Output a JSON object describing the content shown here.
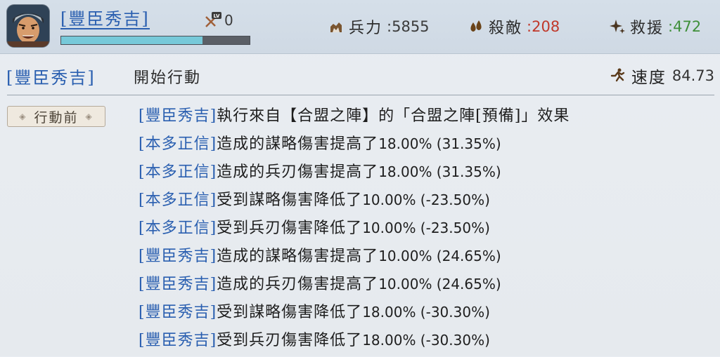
{
  "header": {
    "hero_name": "[豐臣秀吉]",
    "level_value": "0",
    "level_badge": "LV",
    "hp_fraction": 0.75,
    "stats": {
      "troops": {
        "label": "兵力",
        "value": ":5855",
        "icon": "troops-icon"
      },
      "kills": {
        "label": "殺敵",
        "value": ":208",
        "icon": "blood-drops-icon",
        "color": "#c0392b"
      },
      "rescue": {
        "label": "救援",
        "value": ":472",
        "icon": "sparkle-icon",
        "color": "#3f8f3a"
      }
    }
  },
  "turn": {
    "actor": "[豐臣秀吉]",
    "action": "開始行動",
    "speed_label": "速度",
    "speed_value": "84.73"
  },
  "phase_label": "行動前",
  "log": [
    {
      "who": "[豐臣秀吉]",
      "text": "執行來自【合盟之陣】的「合盟之陣[預備]」效果",
      "num": ""
    },
    {
      "who": "[本多正信]",
      "text": "造成的謀略傷害提高了",
      "num": "18.00% (31.35%)"
    },
    {
      "who": "[本多正信]",
      "text": "造成的兵刃傷害提高了",
      "num": "18.00% (31.35%)"
    },
    {
      "who": "[本多正信]",
      "text": "受到謀略傷害降低了",
      "num": "10.00% (-23.50%)"
    },
    {
      "who": "[本多正信]",
      "text": "受到兵刃傷害降低了",
      "num": "10.00% (-23.50%)"
    },
    {
      "who": "[豐臣秀吉]",
      "text": "造成的謀略傷害提高了",
      "num": "10.00% (24.65%)"
    },
    {
      "who": "[豐臣秀吉]",
      "text": "造成的兵刃傷害提高了",
      "num": "10.00% (24.65%)"
    },
    {
      "who": "[豐臣秀吉]",
      "text": "受到謀略傷害降低了",
      "num": "18.00% (-30.30%)"
    },
    {
      "who": "[豐臣秀吉]",
      "text": "受到兵刃傷害降低了",
      "num": "18.00% (-30.30%)"
    }
  ]
}
